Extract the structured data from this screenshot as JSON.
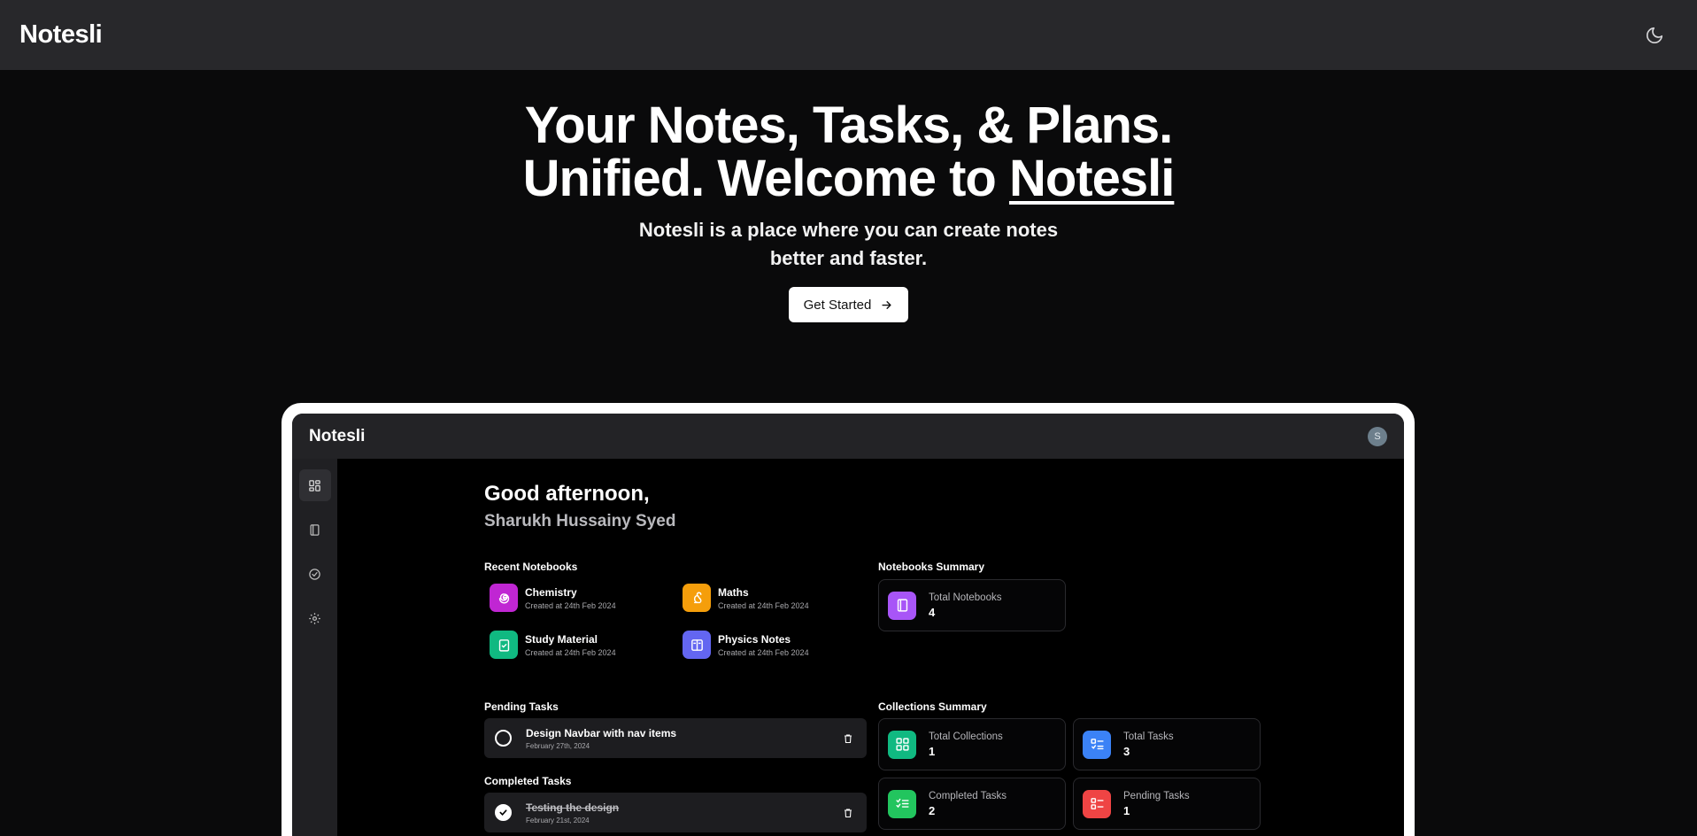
{
  "header": {
    "brand": "Notesli"
  },
  "hero": {
    "title_line1": "Your Notes, Tasks, & Plans.",
    "title_line2_prefix": "Unified. Welcome to ",
    "title_line2_brand": "Notesli",
    "subtitle": "Notesli is a place where you can create notes better and faster.",
    "cta_label": "Get Started"
  },
  "app": {
    "brand": "Notesli",
    "avatar_initial": "S",
    "greeting": "Good afternoon,",
    "user_name": "Sharukh Hussainy Syed",
    "recent_notebooks_title": "Recent Notebooks",
    "notebooks": [
      {
        "name": "Chemistry",
        "date": "Created at 24th Feb 2024",
        "icon": "spiral-icon",
        "color": "#c026d3"
      },
      {
        "name": "Maths",
        "date": "Created at 24th Feb 2024",
        "icon": "squirrel-icon",
        "color": "#f59e0b"
      },
      {
        "name": "Study Material",
        "date": "Created at 24th Feb 2024",
        "icon": "clipboard-check-icon",
        "color": "#10b981"
      },
      {
        "name": "Physics Notes",
        "date": "Created at 24th Feb 2024",
        "icon": "book-open-icon",
        "color": "#6366f1"
      }
    ],
    "notebooks_summary_title": "Notebooks Summary",
    "total_notebooks": {
      "label": "Total Notebooks",
      "value": "4",
      "color": "#a855f7"
    },
    "pending_tasks_title": "Pending Tasks",
    "pending_tasks": [
      {
        "name": "Design Navbar with nav items",
        "date": "February 27th, 2024"
      }
    ],
    "completed_tasks_title": "Completed Tasks",
    "completed_tasks": [
      {
        "name": "Testing the design",
        "date": "February 21st, 2024"
      }
    ],
    "collections_summary_title": "Collections Summary",
    "collections": [
      {
        "label": "Total Collections",
        "value": "1",
        "color": "#10b981",
        "icon": "grid-icon"
      },
      {
        "label": "Total Tasks",
        "value": "3",
        "color": "#3b82f6",
        "icon": "list-check-icon"
      },
      {
        "label": "Completed Tasks",
        "value": "2",
        "color": "#22c55e",
        "icon": "list-checks-icon"
      },
      {
        "label": "Pending Tasks",
        "value": "1",
        "color": "#ef4444",
        "icon": "list-todo-icon"
      }
    ]
  }
}
